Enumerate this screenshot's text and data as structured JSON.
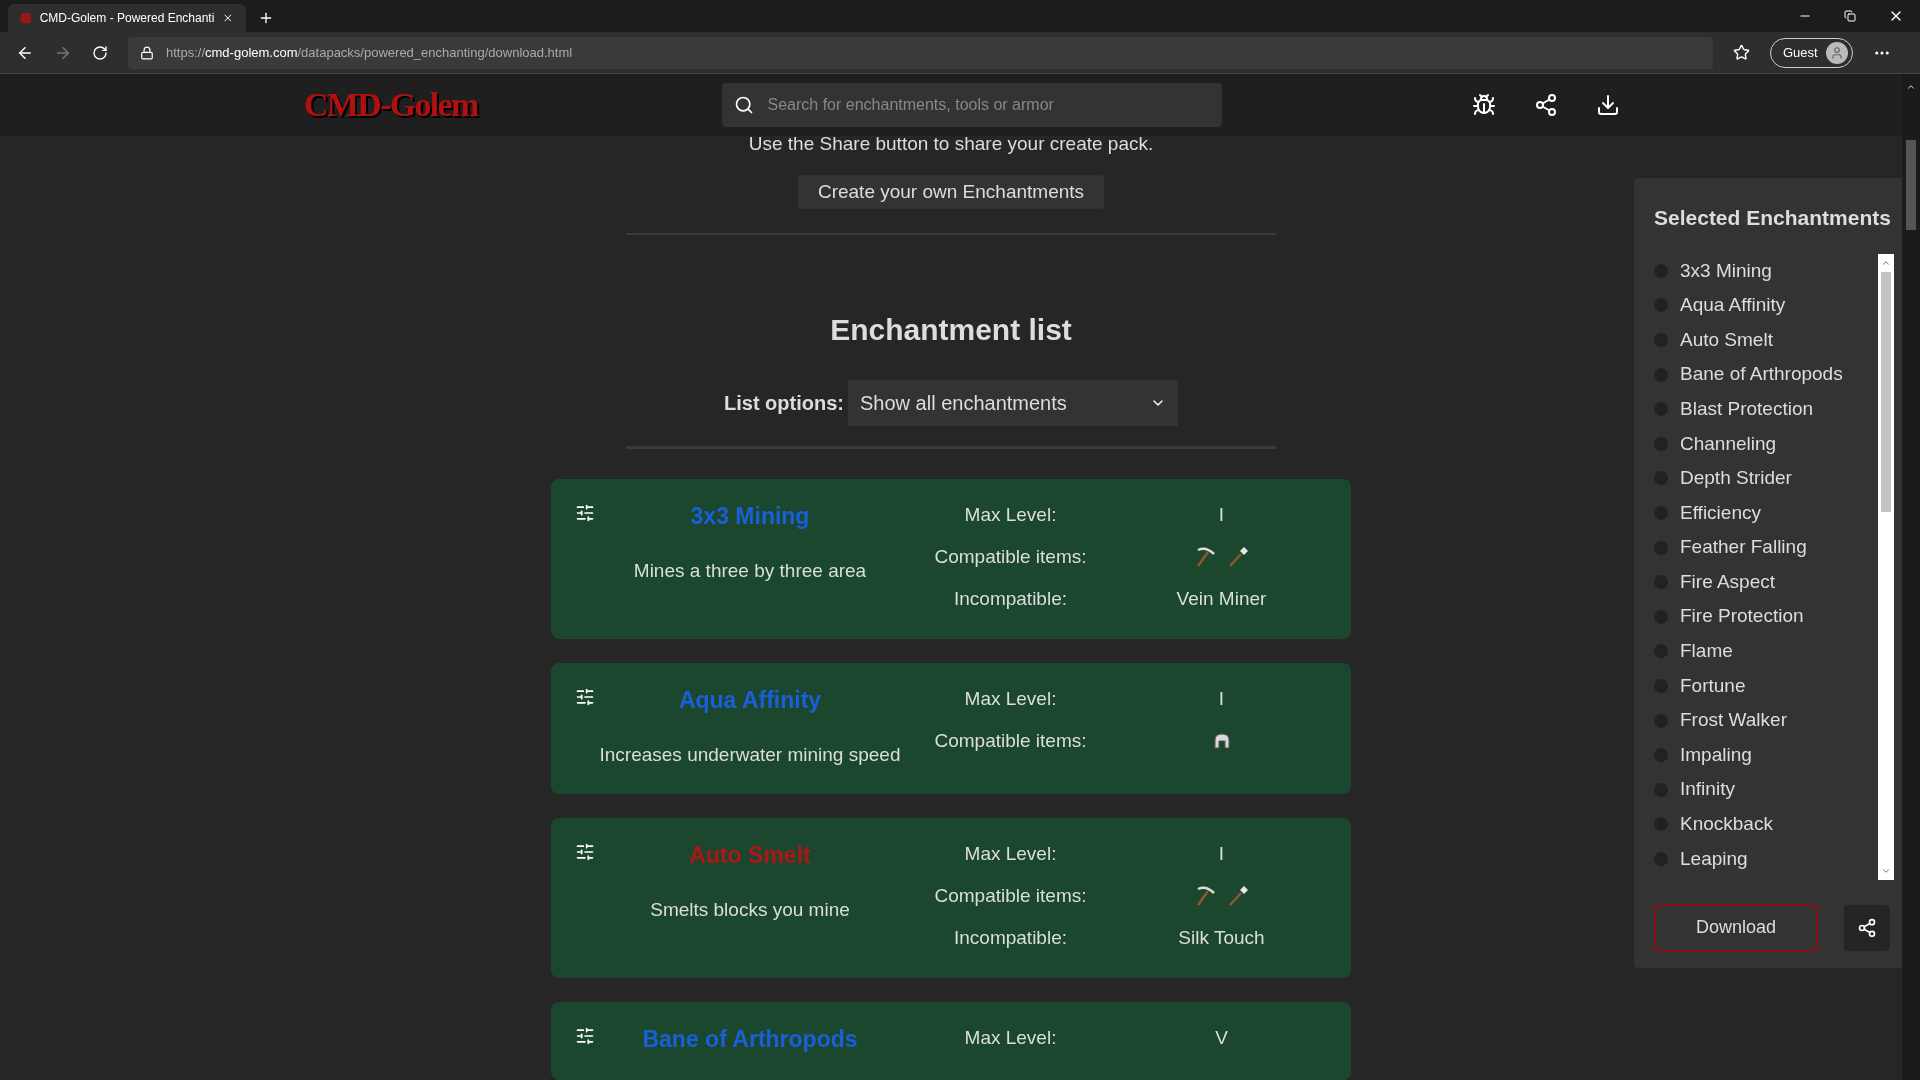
{
  "browser": {
    "tab_title": "CMD-Golem - Powered Enchanti",
    "url_scheme": "https://",
    "url_host": "cmd-golem.com",
    "url_path": "/datapacks/powered_enchanting/download.html",
    "profile": "Guest"
  },
  "header": {
    "logo": "CMD-Golem",
    "search_placeholder": "Search for enchantments, tools or armor"
  },
  "intro_text": "Use the Share button to share your create pack.",
  "create_button": "Create your own Enchantments",
  "list_heading": "Enchantment list",
  "list_options": {
    "label": "List options:",
    "value": "Show all enchantments"
  },
  "enchantments": [
    {
      "name": "3x3 Mining",
      "color": "#1a5fd8",
      "description": "Mines a three by three area",
      "rows": [
        {
          "label": "Max Level:",
          "kind": "text",
          "value": "I"
        },
        {
          "label": "Compatible items:",
          "kind": "items",
          "items": [
            {
              "kind": "pickaxe"
            },
            {
              "kind": "shovel"
            }
          ]
        },
        {
          "label": "Incompatible:",
          "kind": "text",
          "value": "Vein Miner"
        }
      ]
    },
    {
      "name": "Aqua Affinity",
      "color": "#1a5fd8",
      "description": "Increases underwater mining speed",
      "rows": [
        {
          "label": "Max Level:",
          "kind": "text",
          "value": "I"
        },
        {
          "label": "Compatible items:",
          "kind": "items",
          "items": [
            {
              "kind": "helmet"
            }
          ]
        }
      ]
    },
    {
      "name": "Auto Smelt",
      "color": "#b01616",
      "description": "Smelts blocks you mine",
      "rows": [
        {
          "label": "Max Level:",
          "kind": "text",
          "value": "I"
        },
        {
          "label": "Compatible items:",
          "kind": "items",
          "items": [
            {
              "kind": "pickaxe"
            },
            {
              "kind": "shovel"
            }
          ]
        },
        {
          "label": "Incompatible:",
          "kind": "text",
          "value": "Silk Touch"
        }
      ]
    },
    {
      "name": "Bane of Arthropods",
      "color": "#1a5fd8",
      "rows": [
        {
          "label": "Max Level:",
          "kind": "text",
          "value": "V"
        }
      ]
    }
  ],
  "sidebar": {
    "title": "Selected Enchantments",
    "items": [
      {
        "label": "3x3 Mining",
        "selected": false
      },
      {
        "label": "Aqua Affinity",
        "selected": false
      },
      {
        "label": "Auto Smelt",
        "selected": false
      },
      {
        "label": "Bane of Arthropods",
        "selected": false
      },
      {
        "label": "Blast Protection",
        "selected": false
      },
      {
        "label": "Channeling",
        "selected": false
      },
      {
        "label": "Depth Strider",
        "selected": false
      },
      {
        "label": "Efficiency",
        "selected": false
      },
      {
        "label": "Feather Falling",
        "selected": false
      },
      {
        "label": "Fire Aspect",
        "selected": false
      },
      {
        "label": "Fire Protection",
        "selected": false
      },
      {
        "label": "Flame",
        "selected": false
      },
      {
        "label": "Fortune",
        "selected": false
      },
      {
        "label": "Frost Walker",
        "selected": false
      },
      {
        "label": "Impaling",
        "selected": false
      },
      {
        "label": "Infinity",
        "selected": false
      },
      {
        "label": "Knockback",
        "selected": false
      },
      {
        "label": "Leaping",
        "selected": false
      }
    ],
    "download_button": "Download"
  }
}
